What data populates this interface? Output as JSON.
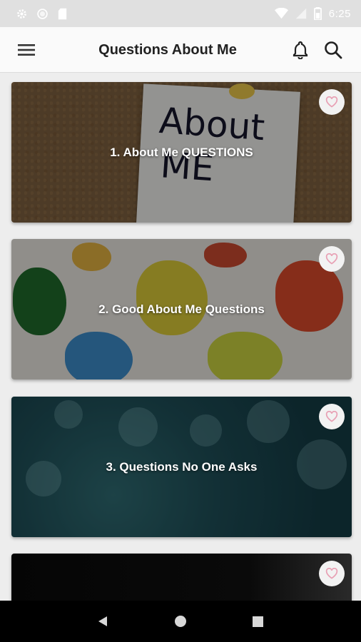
{
  "status_bar": {
    "time": "6:25",
    "icons": [
      "settings-icon",
      "circle-icon",
      "sd-card-icon",
      "wifi-icon",
      "signal-icon",
      "battery-icon"
    ]
  },
  "app_bar": {
    "title": "Questions About Me",
    "icons": [
      "menu-icon",
      "bell-icon",
      "search-icon"
    ]
  },
  "cards": [
    {
      "title": "1. About Me QUESTIONS",
      "image_text": [
        "About",
        "ME"
      ]
    },
    {
      "title": "2. Good About Me Questions"
    },
    {
      "title": "3. Questions No One Asks"
    },
    {
      "title": ""
    }
  ],
  "nav_bar": {
    "icons": [
      "back-icon",
      "home-icon",
      "recents-icon"
    ]
  },
  "colors": {
    "heart_outline": "#e8a0b4",
    "app_bar_bg": "#fafafa",
    "page_bg": "#ededed",
    "status_bar_bg": "#e0e0e0"
  }
}
